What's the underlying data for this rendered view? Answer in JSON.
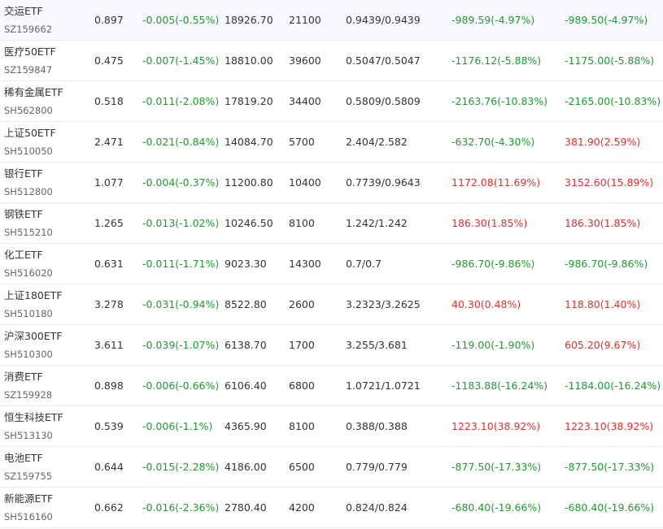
{
  "colors": {
    "gain": "#e0302f",
    "loss": "#1e9b2f",
    "text": "#333333",
    "code_text": "#666666",
    "row_border": "#ebebeb"
  },
  "rows": [
    {
      "name": "交运ETF",
      "code": "SZ159662",
      "price": "0.897",
      "change": "-0.005(-0.55%)",
      "market_value": "18926.70",
      "shares": "21100",
      "cost": "0.9439/0.9439",
      "pl": "-989.59(-4.97%)",
      "pl_dir": "loss",
      "total_pl": "-989.50(-4.97%)",
      "total_pl_dir": "loss"
    },
    {
      "name": "医疗50ETF",
      "code": "SZ159847",
      "price": "0.475",
      "change": "-0.007(-1.45%)",
      "market_value": "18810.00",
      "shares": "39600",
      "cost": "0.5047/0.5047",
      "pl": "-1176.12(-5.88%)",
      "pl_dir": "loss",
      "total_pl": "-1175.00(-5.88%)",
      "total_pl_dir": "loss"
    },
    {
      "name": "稀有金属ETF",
      "code": "SH562800",
      "price": "0.518",
      "change": "-0.011(-2.08%)",
      "market_value": "17819.20",
      "shares": "34400",
      "cost": "0.5809/0.5809",
      "pl": "-2163.76(-10.83%)",
      "pl_dir": "loss",
      "total_pl": "-2165.00(-10.83%)",
      "total_pl_dir": "loss"
    },
    {
      "name": "上证50ETF",
      "code": "SH510050",
      "price": "2.471",
      "change": "-0.021(-0.84%)",
      "market_value": "14084.70",
      "shares": "5700",
      "cost": "2.404/2.582",
      "pl": "-632.70(-4.30%)",
      "pl_dir": "loss",
      "total_pl": "381.90(2.59%)",
      "total_pl_dir": "gain"
    },
    {
      "name": "银行ETF",
      "code": "SH512800",
      "price": "1.077",
      "change": "-0.004(-0.37%)",
      "market_value": "11200.80",
      "shares": "10400",
      "cost": "0.7739/0.9643",
      "pl": "1172.08(11.69%)",
      "pl_dir": "gain",
      "total_pl": "3152.60(15.89%)",
      "total_pl_dir": "gain"
    },
    {
      "name": "钢铁ETF",
      "code": "SH515210",
      "price": "1.265",
      "change": "-0.013(-1.02%)",
      "market_value": "10246.50",
      "shares": "8100",
      "cost": "1.242/1.242",
      "pl": "186.30(1.85%)",
      "pl_dir": "gain",
      "total_pl": "186.30(1.85%)",
      "total_pl_dir": "gain"
    },
    {
      "name": "化工ETF",
      "code": "SH516020",
      "price": "0.631",
      "change": "-0.011(-1.71%)",
      "market_value": "9023.30",
      "shares": "14300",
      "cost": "0.7/0.7",
      "pl": "-986.70(-9.86%)",
      "pl_dir": "loss",
      "total_pl": "-986.70(-9.86%)",
      "total_pl_dir": "loss"
    },
    {
      "name": "上证180ETF",
      "code": "SH510180",
      "price": "3.278",
      "change": "-0.031(-0.94%)",
      "market_value": "8522.80",
      "shares": "2600",
      "cost": "3.2323/3.2625",
      "pl": "40.30(0.48%)",
      "pl_dir": "gain",
      "total_pl": "118.80(1.40%)",
      "total_pl_dir": "gain"
    },
    {
      "name": "沪深300ETF",
      "code": "SH510300",
      "price": "3.611",
      "change": "-0.039(-1.07%)",
      "market_value": "6138.70",
      "shares": "1700",
      "cost": "3.255/3.681",
      "pl": "-119.00(-1.90%)",
      "pl_dir": "loss",
      "total_pl": "605.20(9.67%)",
      "total_pl_dir": "gain"
    },
    {
      "name": "消费ETF",
      "code": "SZ159928",
      "price": "0.898",
      "change": "-0.006(-0.66%)",
      "market_value": "6106.40",
      "shares": "6800",
      "cost": "1.0721/1.0721",
      "pl": "-1183.88(-16.24%)",
      "pl_dir": "loss",
      "total_pl": "-1184.00(-16.24%)",
      "total_pl_dir": "loss"
    },
    {
      "name": "恒生科技ETF",
      "code": "SH513130",
      "price": "0.539",
      "change": "-0.006(-1.1%)",
      "market_value": "4365.90",
      "shares": "8100",
      "cost": "0.388/0.388",
      "pl": "1223.10(38.92%)",
      "pl_dir": "gain",
      "total_pl": "1223.10(38.92%)",
      "total_pl_dir": "gain"
    },
    {
      "name": "电池ETF",
      "code": "SZ159755",
      "price": "0.644",
      "change": "-0.015(-2.28%)",
      "market_value": "4186.00",
      "shares": "6500",
      "cost": "0.779/0.779",
      "pl": "-877.50(-17.33%)",
      "pl_dir": "loss",
      "total_pl": "-877.50(-17.33%)",
      "total_pl_dir": "loss"
    },
    {
      "name": "新能源ETF",
      "code": "SH516160",
      "price": "0.662",
      "change": "-0.016(-2.36%)",
      "market_value": "2780.40",
      "shares": "4200",
      "cost": "0.824/0.824",
      "pl": "-680.40(-19.66%)",
      "pl_dir": "loss",
      "total_pl": "-680.40(-19.66%)",
      "total_pl_dir": "loss"
    }
  ]
}
